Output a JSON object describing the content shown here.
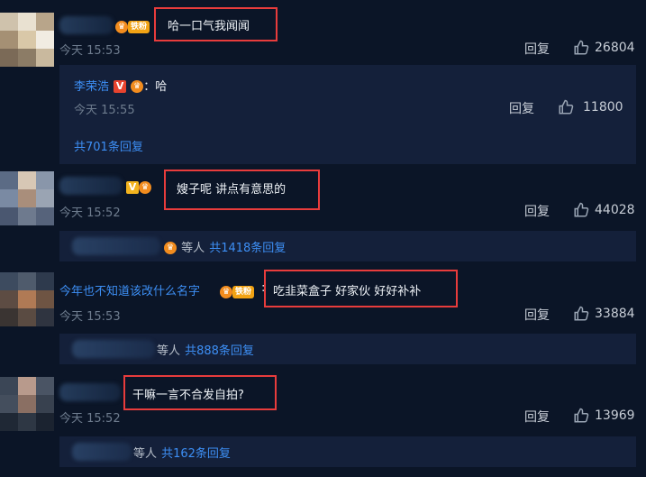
{
  "comments": [
    {
      "username_visible": "",
      "badge": "铁粉",
      "text": "哈一口气我闻闻",
      "time": "今天 15:53",
      "reply_label": "回复",
      "likes": "26804",
      "sub": {
        "reply_user": "李荣浩",
        "reply_text": "哈",
        "reply_time": "今天 15:55",
        "reply_label": "回复",
        "reply_likes": "11800",
        "more_link": "共701条回复"
      }
    },
    {
      "username_visible": "",
      "text": "嫂子呢 讲点有意思的",
      "time": "今天 15:52",
      "reply_label": "回复",
      "likes": "44028",
      "sub": {
        "others": "等人",
        "more_link": "共1418条回复"
      }
    },
    {
      "username_visible": "今年也不知道该改什么名字",
      "badge": "铁粉",
      "text": "吃韭菜盒子 好家伙 好好补补",
      "time": "今天 15:53",
      "reply_label": "回复",
      "likes": "33884",
      "sub": {
        "others": "等人",
        "more_link": "共888条回复"
      }
    },
    {
      "username_visible": "",
      "text": "干嘛一言不合发自拍?",
      "time": "今天 15:52",
      "reply_label": "回复",
      "likes": "13969",
      "sub": {
        "others": "等人",
        "more_link": "共162条回复"
      }
    }
  ],
  "colors": {
    "bg": "#0b1527",
    "subbox": "#14203a",
    "link": "#3d8ff5",
    "highlight": "#e83c3c"
  },
  "icons": {
    "like": "thumbs-up-icon",
    "crown": "crown-icon",
    "verified": "v-icon"
  }
}
